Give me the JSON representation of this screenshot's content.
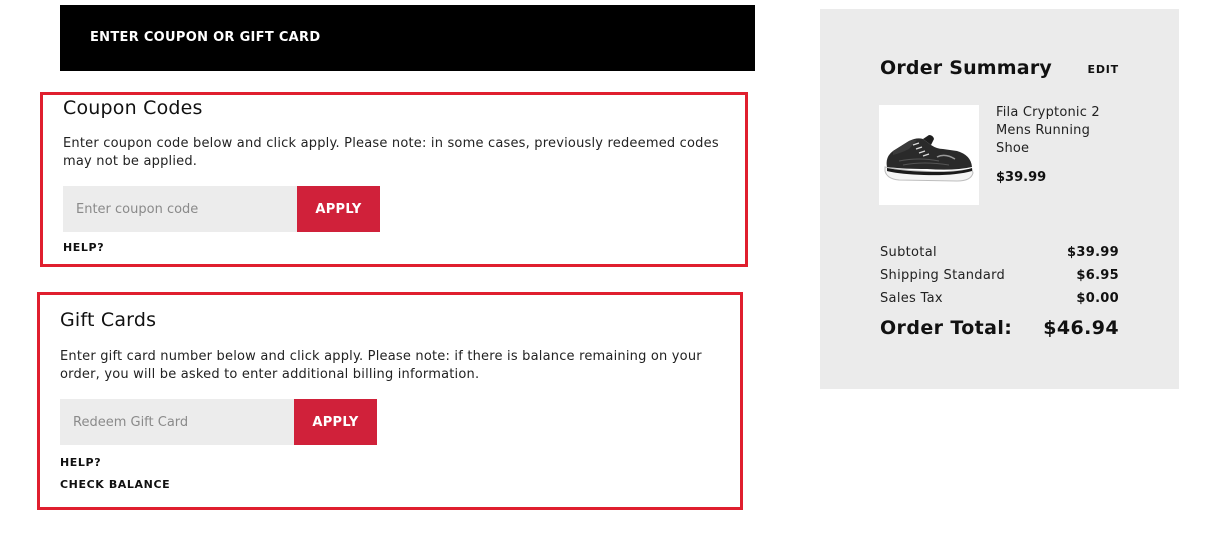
{
  "coupon_header": {
    "label": "ENTER COUPON OR GIFT CARD"
  },
  "coupon": {
    "title": "Coupon Codes",
    "description": "Enter coupon code below and click apply. Please note: in some cases, previously redeemed codes may not be applied.",
    "input_placeholder": "Enter coupon code",
    "apply_label": "APPLY",
    "help_label": "HELP?"
  },
  "gift": {
    "title": "Gift Cards",
    "description": "Enter gift card number below and click apply. Please note: if there is balance remaining on your order, you will be asked to enter additional billing information.",
    "input_placeholder": "Redeem Gift Card",
    "apply_label": "APPLY",
    "help_label": "HELP?",
    "balance_label": "CHECK BALANCE"
  },
  "summary": {
    "title": "Order Summary",
    "edit_label": "EDIT",
    "product": {
      "name": "Fila Cryptonic 2 Mens Running Shoe",
      "price": "$39.99"
    },
    "subtotal_label": "Subtotal",
    "subtotal_value": "$39.99",
    "shipping_label": "Shipping Standard",
    "shipping_value": "$6.95",
    "tax_label": "Sales Tax",
    "tax_value": "$0.00",
    "total_label": "Order Total:",
    "total_value": "$46.94"
  },
  "colors": {
    "accent": "#d0213a",
    "highlight_border": "#e01f2e",
    "panel_bg": "#ebebeb",
    "header_bg": "#000000"
  },
  "icons": {
    "product_image": "running-shoe-image"
  }
}
